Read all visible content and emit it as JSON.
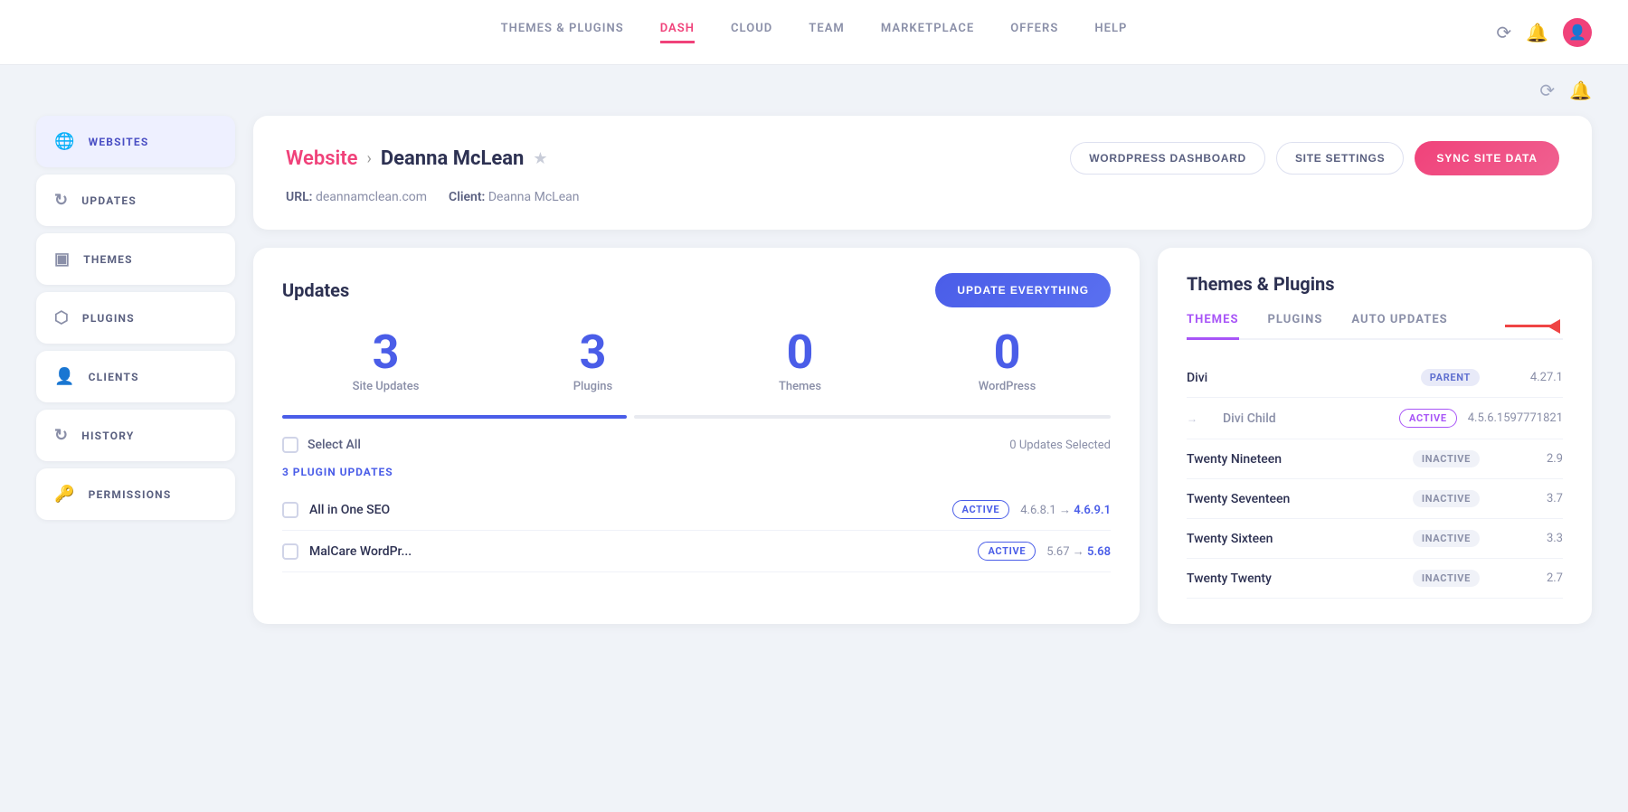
{
  "nav": {
    "items": [
      {
        "label": "THEMES & PLUGINS",
        "active": false
      },
      {
        "label": "DASH",
        "active": true
      },
      {
        "label": "CLOUD",
        "active": false
      },
      {
        "label": "TEAM",
        "active": false
      },
      {
        "label": "MARKETPLACE",
        "active": false
      },
      {
        "label": "OFFERS",
        "active": false
      },
      {
        "label": "HELP",
        "active": false
      }
    ]
  },
  "sidebar": {
    "items": [
      {
        "label": "WEBSITES",
        "icon": "🌐",
        "active": true
      },
      {
        "label": "UPDATES",
        "icon": "↻",
        "active": false
      },
      {
        "label": "THEMES",
        "icon": "▣",
        "active": false
      },
      {
        "label": "PLUGINS",
        "icon": "⬡",
        "active": false
      },
      {
        "label": "CLIENTS",
        "icon": "👤",
        "active": false
      },
      {
        "label": "HISTORY",
        "icon": "↻",
        "active": false
      },
      {
        "label": "PERMISSIONS",
        "icon": "🔑",
        "active": false
      }
    ]
  },
  "site": {
    "breadcrumb_website": "Website",
    "breadcrumb_arrow": "›",
    "name": "Deanna McLean",
    "url_label": "URL:",
    "url_value": "deannamclean.com",
    "client_label": "Client:",
    "client_value": "Deanna McLean"
  },
  "actions": {
    "wordpress_dashboard": "WORDPRESS DASHBOARD",
    "site_settings": "SITE SETTINGS",
    "sync_site_data": "SYNC SITE DATA"
  },
  "updates": {
    "title": "Updates",
    "update_btn": "UPDATE EVERYTHING",
    "stats": [
      {
        "number": "3",
        "label": "Site Updates"
      },
      {
        "number": "3",
        "label": "Plugins"
      },
      {
        "number": "0",
        "label": "Themes"
      },
      {
        "number": "0",
        "label": "WordPress"
      }
    ],
    "select_all": "Select All",
    "updates_selected": "0 Updates Selected",
    "plugin_updates_label": "3 PLUGIN UPDATES",
    "plugins": [
      {
        "name": "All in One SEO",
        "badge": "ACTIVE",
        "version_from": "4.6.8.1",
        "arrow": "→",
        "version_to": "4.6.9.1"
      },
      {
        "name": "MalCare WordPr...",
        "badge": "ACTIVE",
        "version_from": "5.67",
        "arrow": "→",
        "version_to": "5.68"
      }
    ]
  },
  "themes_panel": {
    "title": "Themes & Plugins",
    "tabs": [
      {
        "label": "THEMES",
        "active": true
      },
      {
        "label": "PLUGINS",
        "active": false
      },
      {
        "label": "AUTO UPDATES",
        "active": false
      }
    ],
    "themes": [
      {
        "name": "Divi",
        "badge_type": "parent",
        "badge_label": "PARENT",
        "version": "4.27.1"
      },
      {
        "name": "Divi Child",
        "badge_type": "active",
        "badge_label": "ACTIVE",
        "version": "4.5.6.1597771821",
        "is_child": true
      },
      {
        "name": "Twenty Nineteen",
        "badge_type": "inactive",
        "badge_label": "INACTIVE",
        "version": "2.9"
      },
      {
        "name": "Twenty Seventeen",
        "badge_type": "inactive",
        "badge_label": "INACTIVE",
        "version": "3.7"
      },
      {
        "name": "Twenty Sixteen",
        "badge_type": "inactive",
        "badge_label": "INACTIVE",
        "version": "3.3"
      },
      {
        "name": "Twenty Twenty",
        "badge_type": "inactive",
        "badge_label": "INACTIVE",
        "version": "2.7"
      }
    ]
  }
}
